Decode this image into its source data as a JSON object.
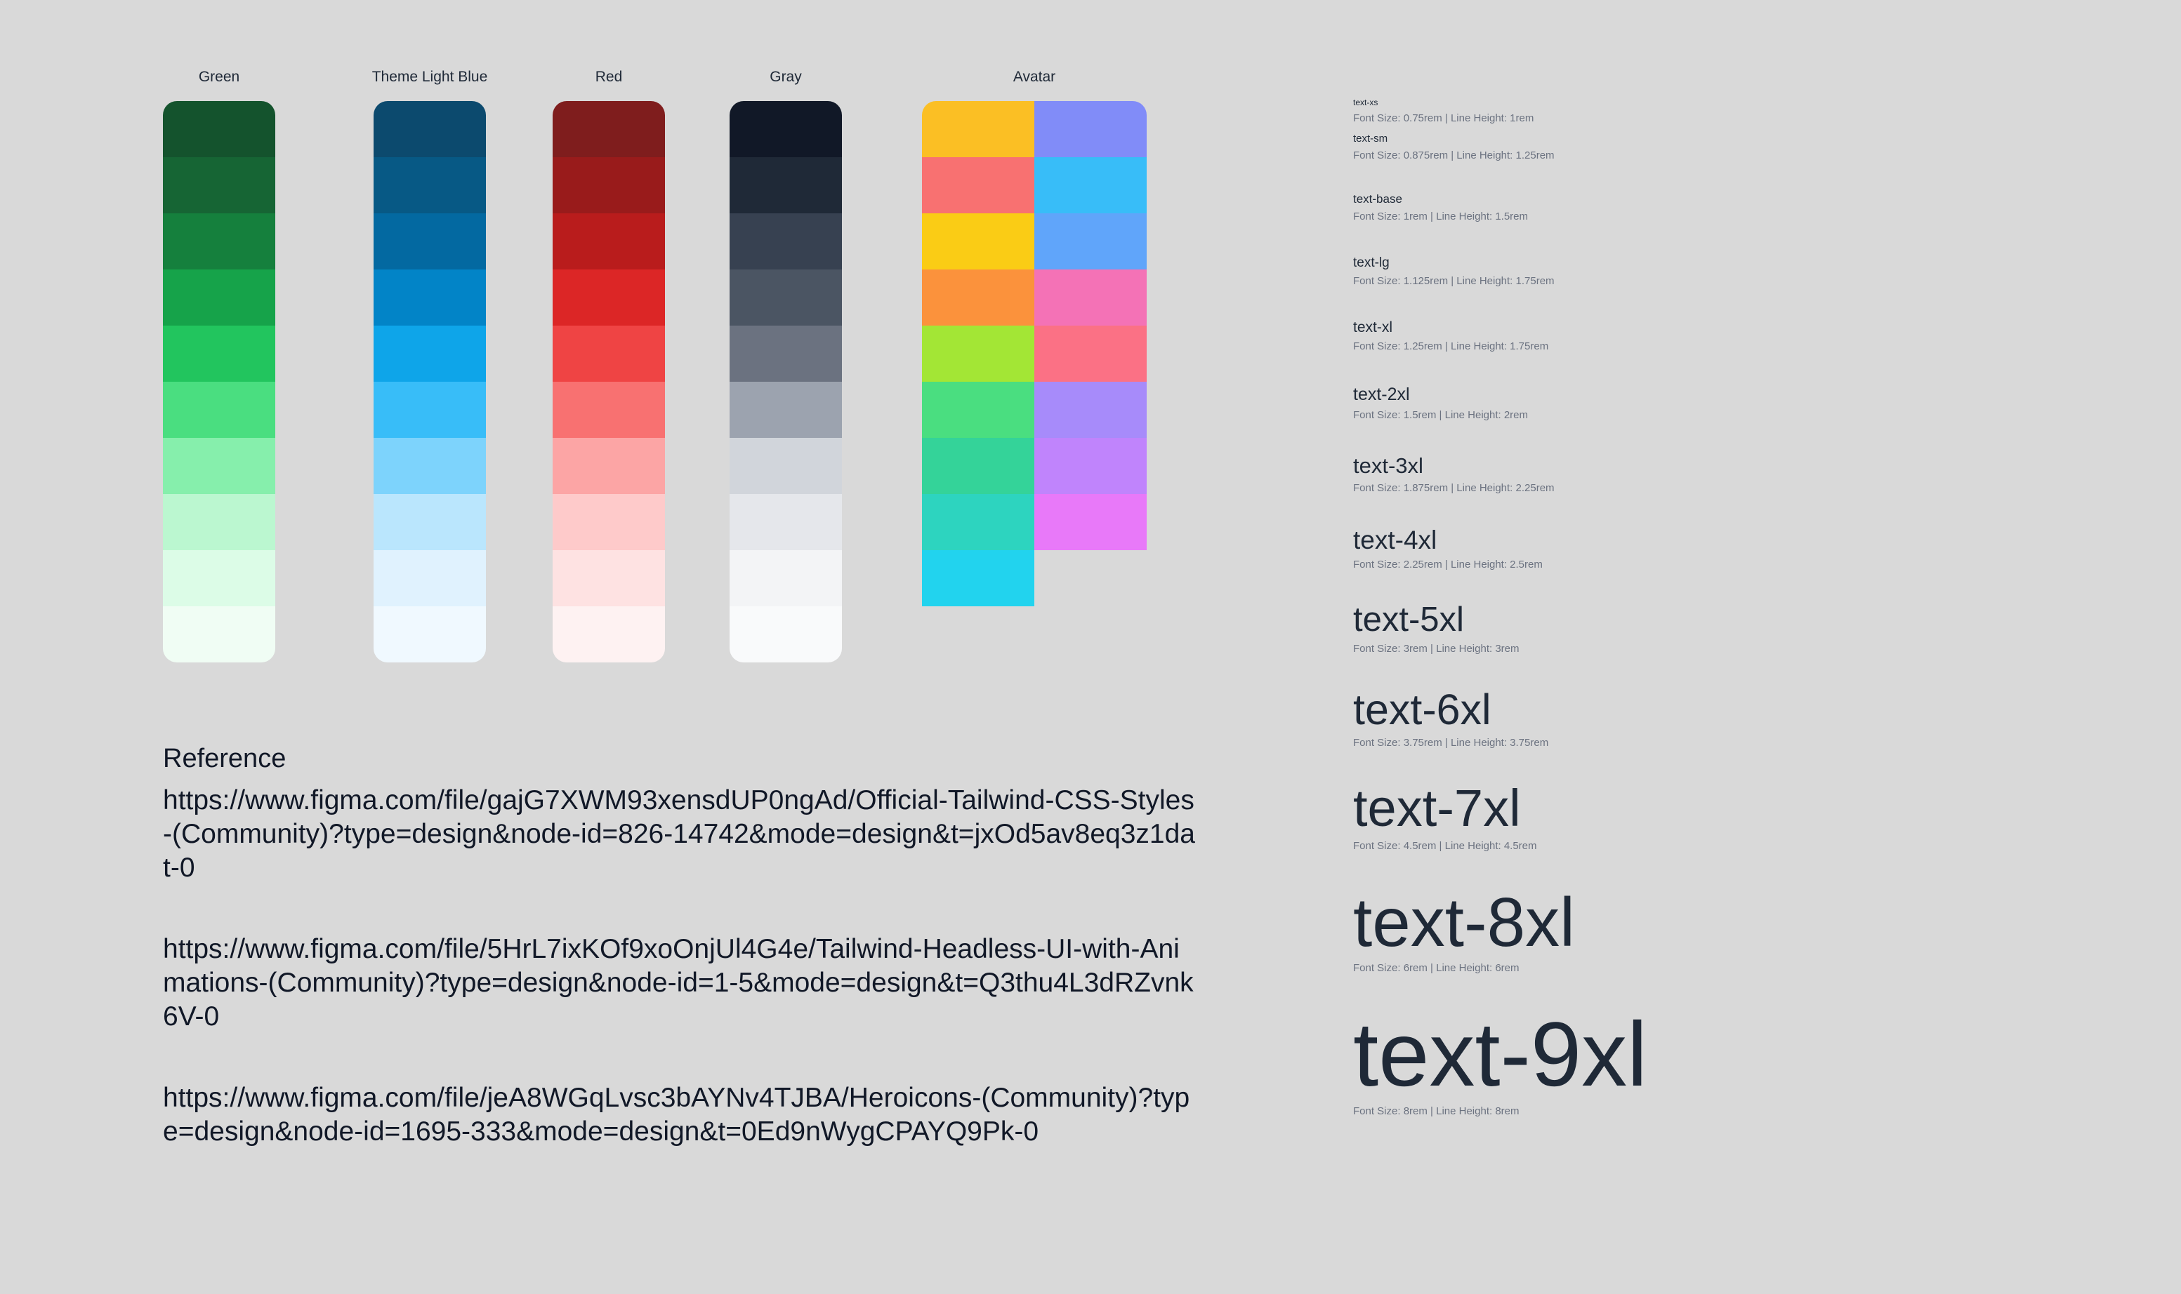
{
  "palettes": [
    {
      "title": "Green",
      "colors": [
        "#14532d",
        "#166534",
        "#15803d",
        "#16a34a",
        "#22c55e",
        "#4ade80",
        "#86efac",
        "#bbf7d0",
        "#dcfce7",
        "#f0fdf4"
      ]
    },
    {
      "title": "Theme Light Blue",
      "colors": [
        "#0c4a6e",
        "#075985",
        "#0369a1",
        "#0284c7",
        "#0ea5e9",
        "#38bdf8",
        "#7dd3fc",
        "#bae6fd",
        "#e0f2fe",
        "#f0f9ff"
      ]
    },
    {
      "title": "Red",
      "colors": [
        "#7f1d1d",
        "#991b1b",
        "#b91c1c",
        "#dc2626",
        "#ef4444",
        "#f87171",
        "#fca5a5",
        "#fecaca",
        "#fee2e2",
        "#fef2f2"
      ]
    },
    {
      "title": "Gray",
      "colors": [
        "#111827",
        "#1f2937",
        "#374151",
        "#4b5563",
        "#6b7280",
        "#9ca3af",
        "#d1d5db",
        "#e5e7eb",
        "#f3f4f6",
        "#f9fafb"
      ]
    }
  ],
  "avatar": {
    "title": "Avatar",
    "left": [
      "#fbbf24",
      "#f87171",
      "#facc15",
      "#fb923c",
      "#a3e635",
      "#4ade80",
      "#34d399",
      "#2dd4bf",
      "#22d3ee"
    ],
    "right": [
      "#818cf8",
      "#38bdf8",
      "#60a5fa",
      "#f472b6",
      "#fb7185",
      "#a78bfa",
      "#c084fc",
      "#e879f9"
    ]
  },
  "reference": {
    "title": "Reference",
    "links": [
      "https://www.figma.com/file/gajG7XWM93xensdUP0ngAd/Official-Tailwind-CSS-Styles-(Community)?type=design&node-id=826-14742&mode=design&t=jxOd5av8eq3z1dat-0",
      "https://www.figma.com/file/5HrL7ixKOf9xoOnjUl4G4e/Tailwind-Headless-UI-with-Animations-(Community)?type=design&node-id=1-5&mode=design&t=Q3thu4L3dRZvnk6V-0",
      "https://www.figma.com/file/jeA8WGqLvsc3bAYNv4TJBA/Heroicons-(Community)?type=design&node-id=1695-333&mode=design&t=0Ed9nWygCPAYQ9Pk-0"
    ]
  },
  "type_scale": [
    {
      "name": "text-xs",
      "desc": "Font Size: 0.75rem | Line Height: 1rem"
    },
    {
      "name": "text-sm",
      "desc": "Font Size: 0.875rem | Line Height: 1.25rem"
    },
    {
      "name": "text-base",
      "desc": "Font Size: 1rem | Line Height: 1.5rem"
    },
    {
      "name": "text-lg",
      "desc": "Font Size: 1.125rem | Line Height: 1.75rem"
    },
    {
      "name": "text-xl",
      "desc": "Font Size: 1.25rem | Line Height: 1.75rem"
    },
    {
      "name": "text-2xl",
      "desc": "Font Size: 1.5rem | Line Height: 2rem"
    },
    {
      "name": "text-3xl",
      "desc": "Font Size: 1.875rem | Line Height: 2.25rem"
    },
    {
      "name": "text-4xl",
      "desc": "Font Size: 2.25rem | Line Height: 2.5rem"
    },
    {
      "name": "text-5xl",
      "desc": "Font Size: 3rem | Line Height: 3rem"
    },
    {
      "name": "text-6xl",
      "desc": "Font Size: 3.75rem | Line Height: 3.75rem"
    },
    {
      "name": "text-7xl",
      "desc": "Font Size: 4.5rem | Line Height: 4.5rem"
    },
    {
      "name": "text-8xl",
      "desc": "Font Size: 6rem | Line Height: 6rem"
    },
    {
      "name": "text-9xl",
      "desc": "Font Size: 8rem | Line Height: 8rem"
    }
  ]
}
